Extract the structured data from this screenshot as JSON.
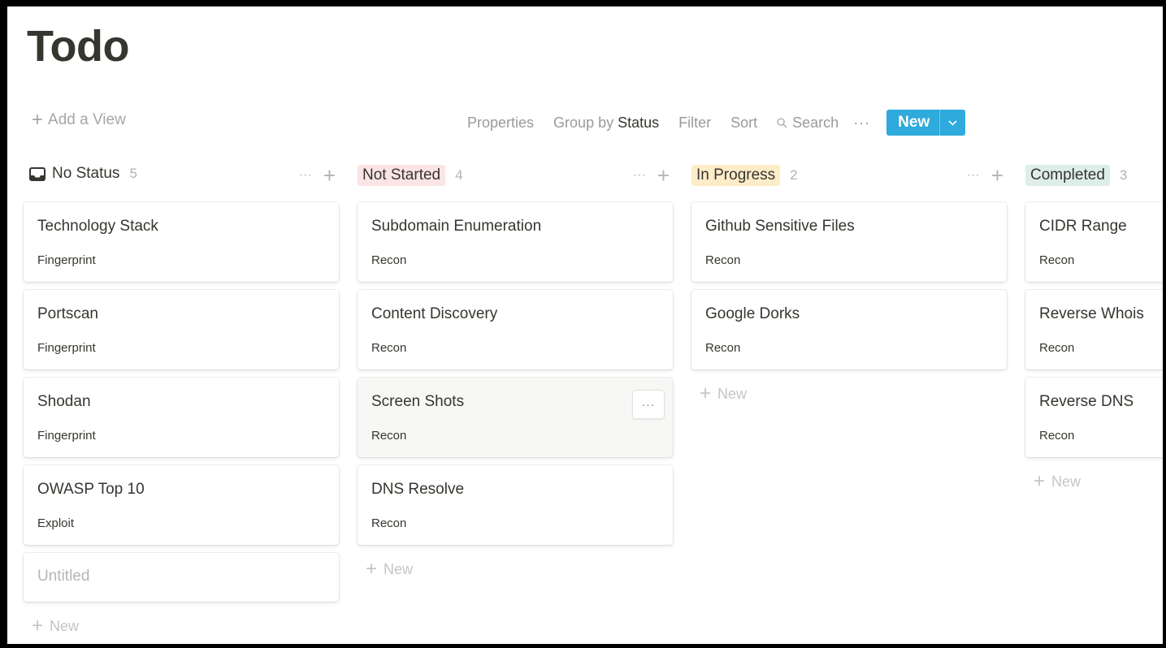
{
  "page": {
    "title": "Todo"
  },
  "toolbar": {
    "add_view": "Add a View",
    "properties": "Properties",
    "group_by_prefix": "Group by ",
    "group_by_value": "Status",
    "filter": "Filter",
    "sort": "Sort",
    "search": "Search",
    "more": "···",
    "new_label": "New"
  },
  "colors": {
    "accent": "#2eaadc",
    "not_started_bg": "#fbe4e4",
    "in_progress_bg": "#fdecc8",
    "completed_bg": "#ddedea"
  },
  "columns": [
    {
      "status": "No Status",
      "count": "5",
      "icon": "inbox-icon",
      "cards": [
        {
          "title": "Technology Stack",
          "tag": "Fingerprint"
        },
        {
          "title": "Portscan",
          "tag": "Fingerprint"
        },
        {
          "title": "Shodan",
          "tag": "Fingerprint"
        },
        {
          "title": "OWASP Top 10",
          "tag": "Exploit"
        },
        {
          "title": "Untitled",
          "tag": ""
        }
      ],
      "new_label": "New"
    },
    {
      "status": "Not Started",
      "count": "4",
      "cards": [
        {
          "title": "Subdomain Enumeration",
          "tag": "Recon"
        },
        {
          "title": "Content Discovery",
          "tag": "Recon"
        },
        {
          "title": "Screen Shots",
          "tag": "Recon"
        },
        {
          "title": "DNS Resolve",
          "tag": "Recon"
        }
      ],
      "new_label": "New"
    },
    {
      "status": "In Progress",
      "count": "2",
      "cards": [
        {
          "title": "Github Sensitive Files",
          "tag": "Recon"
        },
        {
          "title": "Google Dorks",
          "tag": "Recon"
        }
      ],
      "new_label": "New"
    },
    {
      "status": "Completed",
      "count": "3",
      "cards": [
        {
          "title": "CIDR Range",
          "tag": "Recon"
        },
        {
          "title": "Reverse Whois",
          "tag": "Recon"
        },
        {
          "title": "Reverse DNS",
          "tag": "Recon"
        }
      ],
      "new_label": "New"
    }
  ]
}
